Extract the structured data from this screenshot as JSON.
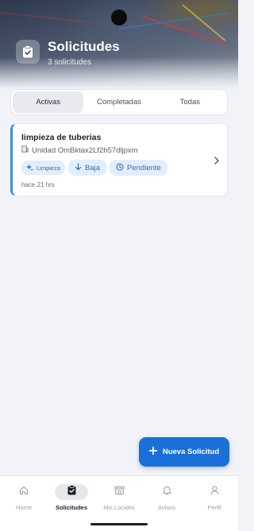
{
  "header": {
    "title": "Solicitudes",
    "subtitle": "3 solicitudes",
    "icon": "clipboard-check-icon"
  },
  "tabs": [
    {
      "label": "Activas",
      "active": true
    },
    {
      "label": "Completadas",
      "active": false
    },
    {
      "label": "Todas",
      "active": false
    }
  ],
  "requests": [
    {
      "title": "limpieza de tuberias",
      "unit": "Unidad OmBktax2Lf2h57dljpxm",
      "category": "Limpieza",
      "priority": "Baja",
      "status": "Pendiente",
      "time": "hace 21 hrs"
    }
  ],
  "fab": {
    "label": "Nueva Solicitud",
    "icon": "plus-icon"
  },
  "nav": [
    {
      "label": "Home",
      "icon": "home-icon",
      "active": false
    },
    {
      "label": "Solicitudes",
      "icon": "clipboard-check-icon",
      "active": true
    },
    {
      "label": "Mis Locales",
      "icon": "store-icon",
      "active": false
    },
    {
      "label": "Avisos",
      "icon": "bell-icon",
      "active": false
    },
    {
      "label": "Perfil",
      "icon": "user-icon",
      "active": false
    }
  ],
  "colors": {
    "accent": "#1a6fd8",
    "chip_bg": "#e3eefb",
    "chip_text": "#2f6fc0",
    "card_border": "#3a8fdc"
  }
}
